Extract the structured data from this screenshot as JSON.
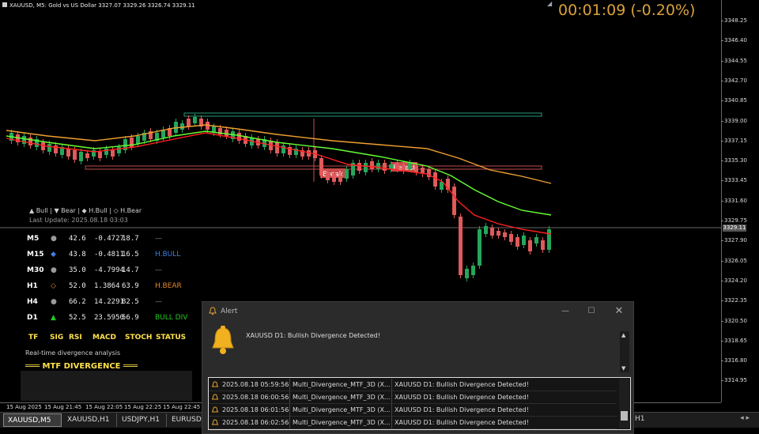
{
  "window": {
    "title": "XAUUSD, M5:  Gold vs US Dollar  3327.07 3329.26 3326.74 3329.11",
    "timer": "00:01:09 (-0.20%)"
  },
  "price_axis": {
    "ticks": [
      "3348.25",
      "3346.40",
      "3344.55",
      "3342.70",
      "3340.85",
      "3339.00",
      "3337.15",
      "3335.30",
      "3333.45",
      "3331.60",
      "3329.75",
      "3327.90",
      "3326.05",
      "3324.20",
      "3322.35",
      "3320.50",
      "3318.65",
      "3316.80",
      "3314.95"
    ],
    "current": "3329.11"
  },
  "chart": {
    "break_label": "Break",
    "retest_label": "Retest"
  },
  "indicator": {
    "legend": "▲ Bull | ▼ Bear | ◆ H.Bull | ◇ H.Bear",
    "last_update": "Last Update: 2025.08.18 03:03",
    "rows": [
      {
        "tf": "M5",
        "sig": "●",
        "sig_color": "#9a9a9a",
        "rsi": "42.6",
        "macd": "-0.4727",
        "stoch": "18.7",
        "status": "—",
        "status_color": "#888888"
      },
      {
        "tf": "M15",
        "sig": "◆",
        "sig_color": "#3f7fe0",
        "rsi": "43.8",
        "macd": "-0.4811",
        "stoch": "16.5",
        "status": "H.BULL",
        "status_color": "#3f7fe0"
      },
      {
        "tf": "M30",
        "sig": "●",
        "sig_color": "#9a9a9a",
        "rsi": "35.0",
        "macd": "-4.7994",
        "stoch": "14.7",
        "status": "—",
        "status_color": "#888888"
      },
      {
        "tf": "H1",
        "sig": "◇",
        "sig_color": "#e08a2a",
        "rsi": "52.0",
        "macd": "1.3864",
        "stoch": "63.9",
        "status": "H.BEAR",
        "status_color": "#e08a2a"
      },
      {
        "tf": "H4",
        "sig": "●",
        "sig_color": "#9a9a9a",
        "rsi": "66.2",
        "macd": "14.2291",
        "stoch": "82.5",
        "status": "—",
        "status_color": "#888888"
      },
      {
        "tf": "D1",
        "sig": "▲",
        "sig_color": "#22cc22",
        "rsi": "52.5",
        "macd": "23.5950",
        "stoch": "56.9",
        "status": "BULL DIV",
        "status_color": "#22cc22"
      }
    ],
    "headers": [
      "TF",
      "SIG",
      "RSI",
      "MACD",
      "STOCH",
      "STATUS"
    ],
    "realtime": "Real-time divergence analysis",
    "title": "═══ MTF DIVERGENCE ═══"
  },
  "time_axis": [
    "15 Aug 2025",
    "15 Aug 21:45",
    "15 Aug 22:05",
    "15 Aug 22:25",
    "15 Aug 22:45"
  ],
  "tabs": [
    "XAUUSD,M5",
    "XAUUSD,H1",
    "USDJPY,H1",
    "EURUSD,"
  ],
  "tab_tail": "H1",
  "alert": {
    "title": "Alert",
    "message": "XAUUSD D1: Bullish Divergence Detected!",
    "rows": [
      {
        "time": "2025.08.18 05:59:56",
        "expert": "Multi_Divergence_MTF_3D (X...",
        "msg": "XAUUSD D1: Bullish Divergence Detected!"
      },
      {
        "time": "2025.08.18 06:00:56",
        "expert": "Multi_Divergence_MTF_3D (X...",
        "msg": "XAUUSD D1: Bullish Divergence Detected!"
      },
      {
        "time": "2025.08.18 06:01:56",
        "expert": "Multi_Divergence_MTF_3D (X...",
        "msg": "XAUUSD D1: Bullish Divergence Detected!"
      },
      {
        "time": "2025.08.18 06:02:56",
        "expert": "Multi_Divergence_MTF_3D (X...",
        "msg": "XAUUSD D1: Bullish Divergence Detected!"
      }
    ]
  },
  "colors": {
    "bull": "#26a65b",
    "bear": "#e05a5a",
    "ema_fast": "#ff2020",
    "ema_mid": "#66ff33",
    "ema_slow": "#f0a030",
    "timer": "#d9a13a"
  }
}
